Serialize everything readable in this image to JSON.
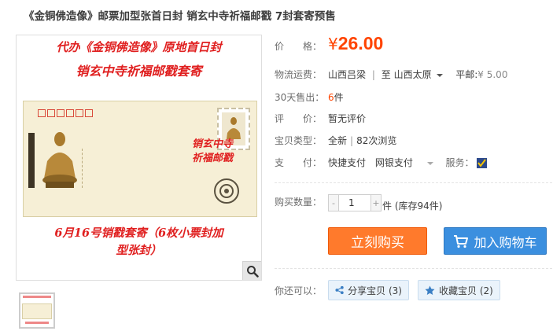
{
  "title": "《金铜佛造像》邮票加型张首日封 销玄中寺祈福邮戳 7封套寄预售",
  "image": {
    "caption_line1": "代办《金铜佛造像》原地首日封",
    "caption_line2": "销玄中寺祈福邮戳套寄",
    "caption_line3": "6月16号销戳套寄（6枚小票封加",
    "caption_line4": "型张封）",
    "cancel_text_line1": "销玄中寺",
    "cancel_text_line2": "祈福邮戳",
    "zoom_icon": "magnifier-icon"
  },
  "price": {
    "label": "价　　格：",
    "currency": "¥",
    "value": "26.00",
    "color": "#ff4400"
  },
  "shipping": {
    "label": "物流运费：",
    "from": "山西吕梁",
    "sep": "|",
    "to_prefix": "至",
    "to": "山西太原",
    "post_label": "平邮:",
    "post_price": "¥ 5.00"
  },
  "sold": {
    "label": "30天售出：",
    "count": "6",
    "unit": "件"
  },
  "rating": {
    "label": "评　　价：",
    "value": "暂无评价"
  },
  "item_type": {
    "label": "宝贝类型：",
    "condition": "全新",
    "sep": "|",
    "views": "82次浏览"
  },
  "payment": {
    "label": "支　　付：",
    "method1": "快捷支付",
    "method2": "网银支付",
    "service_label": "服务："
  },
  "quantity": {
    "label": "购买数量：",
    "value": "1",
    "minus": "-",
    "plus": "+",
    "unit": "件",
    "stock": "(库存94件)"
  },
  "actions": {
    "buy_now": "立刻购买",
    "add_to_cart": "加入购物车",
    "buy_color": "#ff7a2c",
    "cart_color": "#3b8fdf"
  },
  "social": {
    "label": "你还可以：",
    "share": "分享宝贝 (3)",
    "favorite": "收藏宝贝 (2)"
  }
}
